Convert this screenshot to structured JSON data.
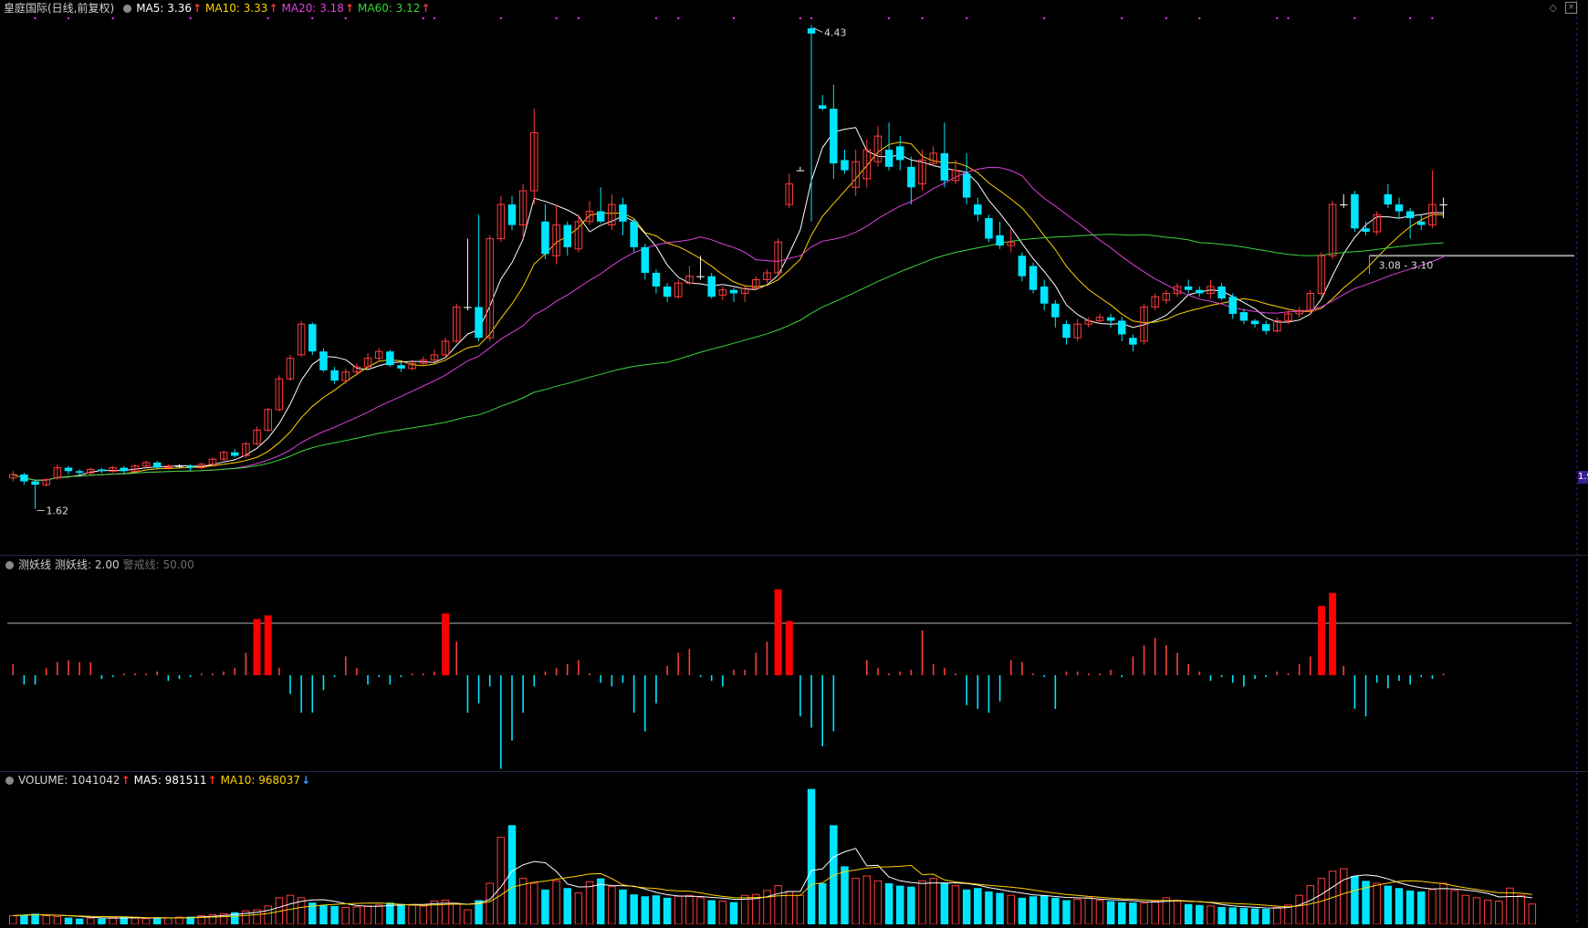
{
  "main": {
    "title": "皇庭国际(日线,前复权)",
    "ma": [
      {
        "label": "MA5: 3.36",
        "color": "#ffffff",
        "trend": "up"
      },
      {
        "label": "MA10: 3.33",
        "color": "#ffd200",
        "trend": "up"
      },
      {
        "label": "MA20: 3.18",
        "color": "#e040e0",
        "trend": "up"
      },
      {
        "label": "MA60: 3.12",
        "color": "#3ad63a",
        "trend": "up"
      }
    ],
    "high_label": "4.43",
    "low_label": "1.62",
    "range_label": "3.08 - 3.10",
    "price_tag": "1.9",
    "ylim": [
      1.5,
      4.5
    ]
  },
  "indicator": {
    "name": "测妖线",
    "value_label": "测妖线: 2.00",
    "warn_label": "警戒线: 50.00"
  },
  "volume": {
    "label": "VOLUME: 1041042",
    "ma5_label": "MA5: 981511",
    "ma10_label": "MA10: 968037",
    "ma5_trend": "up",
    "ma10_trend": "down"
  },
  "colors": {
    "up": "#ff3c3c",
    "down": "#00e5ff",
    "doji": "#ffffff",
    "ma5": "#ffffff",
    "ma10": "#ffd200",
    "ma20": "#e040e0",
    "ma60": "#3ad63a",
    "marker": "#ff33ff"
  },
  "chart_data": {
    "type": "candlestick",
    "candles": [
      [
        1.8,
        1.82,
        1.84,
        1.78
      ],
      [
        1.82,
        1.78,
        1.83,
        1.76
      ],
      [
        1.78,
        1.76,
        1.79,
        1.62
      ],
      [
        1.76,
        1.79,
        1.8,
        1.75
      ],
      [
        1.8,
        1.86,
        1.88,
        1.79
      ],
      [
        1.86,
        1.84,
        1.87,
        1.82
      ],
      [
        1.84,
        1.83,
        1.85,
        1.81
      ],
      [
        1.83,
        1.85,
        1.86,
        1.82
      ],
      [
        1.85,
        1.84,
        1.86,
        1.83
      ],
      [
        1.84,
        1.86,
        1.87,
        1.83
      ],
      [
        1.86,
        1.84,
        1.87,
        1.82
      ],
      [
        1.84,
        1.87,
        1.88,
        1.83
      ],
      [
        1.87,
        1.89,
        1.9,
        1.86
      ],
      [
        1.89,
        1.86,
        1.9,
        1.85
      ],
      [
        1.86,
        1.87,
        1.88,
        1.85
      ],
      [
        1.87,
        1.87,
        1.88,
        1.86
      ],
      [
        1.87,
        1.86,
        1.88,
        1.84
      ],
      [
        1.86,
        1.88,
        1.89,
        1.85
      ],
      [
        1.88,
        1.91,
        1.92,
        1.87
      ],
      [
        1.91,
        1.95,
        1.96,
        1.9
      ],
      [
        1.95,
        1.93,
        1.97,
        1.92
      ],
      [
        1.93,
        2.0,
        2.01,
        1.92
      ],
      [
        2.0,
        2.08,
        2.1,
        1.99
      ],
      [
        2.08,
        2.2,
        2.21,
        2.07
      ],
      [
        2.2,
        2.38,
        2.4,
        2.19
      ],
      [
        2.38,
        2.5,
        2.52,
        2.37
      ],
      [
        2.52,
        2.7,
        2.72,
        2.51
      ],
      [
        2.7,
        2.54,
        2.71,
        2.52
      ],
      [
        2.54,
        2.43,
        2.56,
        2.42
      ],
      [
        2.43,
        2.37,
        2.45,
        2.35
      ],
      [
        2.37,
        2.42,
        2.44,
        2.35
      ],
      [
        2.42,
        2.45,
        2.47,
        2.4
      ],
      [
        2.45,
        2.5,
        2.53,
        2.44
      ],
      [
        2.5,
        2.54,
        2.56,
        2.48
      ],
      [
        2.54,
        2.46,
        2.55,
        2.45
      ],
      [
        2.46,
        2.44,
        2.48,
        2.42
      ],
      [
        2.44,
        2.47,
        2.49,
        2.43
      ],
      [
        2.47,
        2.49,
        2.51,
        2.46
      ],
      [
        2.49,
        2.52,
        2.55,
        2.48
      ],
      [
        2.52,
        2.6,
        2.62,
        2.51
      ],
      [
        2.6,
        2.8,
        2.82,
        2.59
      ],
      [
        2.8,
        2.8,
        3.2,
        2.78
      ],
      [
        2.8,
        2.62,
        3.34,
        2.6
      ],
      [
        2.62,
        3.2,
        3.22,
        2.6
      ],
      [
        3.2,
        3.4,
        3.45,
        3.18
      ],
      [
        3.4,
        3.28,
        3.45,
        3.25
      ],
      [
        3.28,
        3.48,
        3.52,
        3.2
      ],
      [
        3.48,
        3.82,
        3.96,
        3.4
      ],
      [
        3.3,
        3.11,
        3.4,
        3.08
      ],
      [
        3.1,
        3.28,
        3.4,
        3.05
      ],
      [
        3.28,
        3.15,
        3.3,
        3.1
      ],
      [
        3.14,
        3.3,
        3.34,
        3.12
      ],
      [
        3.3,
        3.36,
        3.42,
        3.28
      ],
      [
        3.36,
        3.3,
        3.5,
        3.29
      ],
      [
        3.28,
        3.4,
        3.46,
        3.25
      ],
      [
        3.4,
        3.3,
        3.44,
        3.22
      ],
      [
        3.3,
        3.15,
        3.32,
        3.12
      ],
      [
        3.15,
        3.0,
        3.17,
        2.96
      ],
      [
        3.0,
        2.92,
        3.02,
        2.88
      ],
      [
        2.92,
        2.86,
        2.94,
        2.83
      ],
      [
        2.86,
        2.94,
        2.96,
        2.85
      ],
      [
        2.94,
        2.98,
        3.04,
        2.93
      ],
      [
        2.98,
        2.98,
        3.1,
        2.96
      ],
      [
        2.98,
        2.86,
        3.0,
        2.85
      ],
      [
        2.87,
        2.9,
        2.92,
        2.84
      ],
      [
        2.9,
        2.88,
        2.91,
        2.83
      ],
      [
        2.88,
        2.91,
        2.93,
        2.83
      ],
      [
        2.91,
        2.96,
        2.98,
        2.9
      ],
      [
        2.96,
        3.0,
        3.02,
        2.94
      ],
      [
        3.0,
        3.18,
        3.2,
        2.98
      ],
      [
        3.4,
        3.52,
        3.58,
        3.38
      ],
      [
        3.6,
        3.6,
        3.62,
        3.6
      ],
      [
        4.43,
        4.4,
        4.45,
        3.3
      ],
      [
        3.98,
        3.96,
        4.04,
        3.95
      ],
      [
        3.96,
        3.64,
        4.1,
        3.55
      ],
      [
        3.66,
        3.6,
        3.72,
        3.58
      ],
      [
        3.5,
        3.65,
        3.72,
        3.45
      ],
      [
        3.55,
        3.72,
        3.78,
        3.5
      ],
      [
        3.65,
        3.8,
        3.86,
        3.62
      ],
      [
        3.72,
        3.62,
        3.88,
        3.6
      ],
      [
        3.74,
        3.66,
        3.8,
        3.6
      ],
      [
        3.62,
        3.5,
        3.68,
        3.4
      ],
      [
        3.52,
        3.66,
        3.72,
        3.48
      ],
      [
        3.64,
        3.7,
        3.74,
        3.62
      ],
      [
        3.7,
        3.54,
        3.88,
        3.5
      ],
      [
        3.54,
        3.6,
        3.66,
        3.52
      ],
      [
        3.58,
        3.44,
        3.7,
        3.4
      ],
      [
        3.4,
        3.34,
        3.44,
        3.3
      ],
      [
        3.32,
        3.2,
        3.34,
        3.18
      ],
      [
        3.22,
        3.16,
        3.3,
        3.14
      ],
      [
        3.16,
        3.18,
        3.26,
        3.12
      ],
      [
        3.1,
        2.98,
        3.12,
        2.95
      ],
      [
        3.04,
        2.9,
        3.06,
        2.88
      ],
      [
        2.92,
        2.82,
        2.96,
        2.78
      ],
      [
        2.82,
        2.74,
        2.84,
        2.68
      ],
      [
        2.7,
        2.62,
        2.72,
        2.58
      ],
      [
        2.62,
        2.7,
        2.73,
        2.6
      ],
      [
        2.7,
        2.72,
        2.74,
        2.68
      ],
      [
        2.72,
        2.74,
        2.76,
        2.7
      ],
      [
        2.74,
        2.72,
        2.76,
        2.68
      ],
      [
        2.72,
        2.64,
        2.74,
        2.6
      ],
      [
        2.62,
        2.58,
        2.64,
        2.54
      ],
      [
        2.6,
        2.8,
        2.82,
        2.58
      ],
      [
        2.8,
        2.86,
        2.88,
        2.78
      ],
      [
        2.84,
        2.88,
        2.9,
        2.82
      ],
      [
        2.88,
        2.92,
        2.94,
        2.86
      ],
      [
        2.92,
        2.9,
        2.96,
        2.88
      ],
      [
        2.9,
        2.88,
        2.92,
        2.86
      ],
      [
        2.88,
        2.92,
        2.96,
        2.85
      ],
      [
        2.92,
        2.85,
        2.94,
        2.84
      ],
      [
        2.86,
        2.76,
        2.88,
        2.73
      ],
      [
        2.77,
        2.72,
        2.79,
        2.7
      ],
      [
        2.72,
        2.7,
        2.73,
        2.68
      ],
      [
        2.7,
        2.66,
        2.72,
        2.64
      ],
      [
        2.66,
        2.72,
        2.74,
        2.65
      ],
      [
        2.72,
        2.76,
        2.78,
        2.7
      ],
      [
        2.76,
        2.78,
        2.8,
        2.74
      ],
      [
        2.78,
        2.88,
        2.9,
        2.76
      ],
      [
        2.88,
        3.1,
        3.12,
        2.86
      ],
      [
        3.1,
        3.4,
        3.42,
        3.08
      ],
      [
        3.4,
        3.4,
        3.46,
        3.38
      ],
      [
        3.46,
        3.26,
        3.48,
        3.24
      ],
      [
        3.26,
        3.24,
        3.3,
        3.22
      ],
      [
        3.24,
        3.34,
        3.36,
        3.22
      ],
      [
        3.46,
        3.4,
        3.52,
        3.38
      ],
      [
        3.4,
        3.36,
        3.44,
        3.32
      ],
      [
        3.36,
        3.32,
        3.38,
        3.2
      ],
      [
        3.3,
        3.28,
        3.34,
        3.25
      ],
      [
        3.28,
        3.4,
        3.6,
        3.26
      ],
      [
        3.4,
        3.4,
        3.44,
        3.32
      ]
    ],
    "indicator_bars": [
      6,
      -5,
      -5,
      4,
      7,
      8,
      7,
      7,
      -2,
      -1,
      1,
      1,
      1,
      2,
      -3,
      -2,
      -1,
      1,
      1,
      2,
      4,
      12,
      30,
      32,
      4,
      -10,
      -20,
      -20,
      -8,
      -1,
      10,
      4,
      -5,
      -1,
      -5,
      -1,
      1,
      1,
      2,
      33,
      18,
      -20,
      -15,
      -6,
      -50,
      -35,
      -20,
      -6,
      2,
      4,
      6,
      8,
      1,
      -4,
      -6,
      -4,
      -20,
      -30,
      -15,
      5,
      12,
      14,
      -1,
      -3,
      -6,
      3,
      3,
      12,
      18,
      46,
      29,
      -22,
      -28,
      -38,
      -30,
      0,
      0,
      8,
      4,
      1,
      2,
      3,
      24,
      6,
      4,
      1,
      -16,
      -18,
      -20,
      -14,
      8,
      7,
      1,
      -1,
      -18,
      2,
      2,
      1,
      1,
      3,
      -1,
      10,
      16,
      20,
      16,
      12,
      6,
      2,
      -3,
      -1,
      -4,
      -6,
      -2,
      -1,
      2,
      1,
      6,
      10,
      37,
      44,
      5,
      -18,
      -22,
      -4,
      -7,
      -3,
      -5,
      -1,
      -2,
      1
    ],
    "volume": [
      18,
      20,
      22,
      18,
      16,
      14,
      12,
      13,
      12,
      14,
      15,
      13,
      12,
      14,
      13,
      15,
      16,
      18,
      20,
      22,
      25,
      28,
      30,
      38,
      55,
      60,
      55,
      45,
      40,
      38,
      35,
      36,
      38,
      40,
      45,
      42,
      40,
      38,
      48,
      50,
      42,
      30,
      50,
      85,
      180,
      205,
      95,
      85,
      72,
      90,
      75,
      65,
      88,
      95,
      78,
      72,
      62,
      58,
      60,
      55,
      58,
      60,
      55,
      50,
      48,
      46,
      60,
      62,
      70,
      80,
      68,
      60,
      280,
      85,
      205,
      120,
      95,
      100,
      90,
      85,
      80,
      78,
      90,
      95,
      85,
      80,
      72,
      75,
      68,
      65,
      60,
      55,
      58,
      60,
      55,
      50,
      52,
      55,
      50,
      48,
      46,
      45,
      44,
      48,
      55,
      50,
      42,
      40,
      38,
      36,
      35,
      34,
      33,
      32,
      35,
      40,
      60,
      80,
      95,
      110,
      115,
      100,
      90,
      85,
      80,
      75,
      70,
      68,
      72,
      85,
      70,
      60,
      55,
      50,
      48,
      75,
      60,
      42
    ]
  }
}
